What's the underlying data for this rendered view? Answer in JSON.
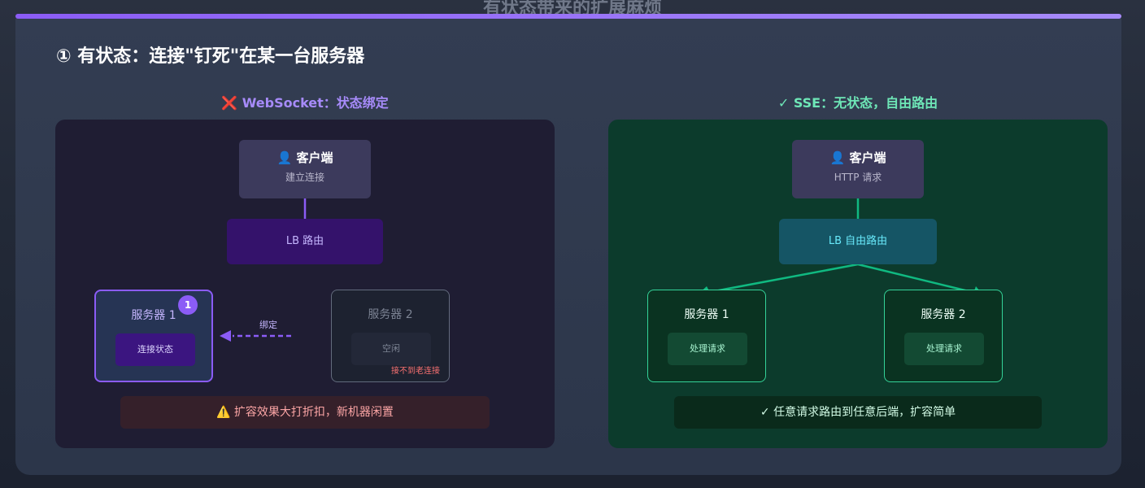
{
  "page": {
    "title": "有状态带来的扩展麻烦",
    "section_title": "① 有状态：连接\"钉死\"在某一台服务器"
  },
  "left": {
    "heading": "❌ WebSocket：状态绑定",
    "client": {
      "icon": "user-icon",
      "title": "👤 客户端",
      "sub": "建立连接"
    },
    "lb": "LB 路由",
    "server1": {
      "title": "服务器 1",
      "inner": "连接状态",
      "badge": "1"
    },
    "bind_label": "绑定",
    "server2": {
      "title": "服务器 2",
      "inner": "空闲",
      "note": "接不到老连接"
    },
    "footer": "⚠️ 扩容效果大打折扣，新机器闲置"
  },
  "right": {
    "heading": "✓ SSE：无状态，自由路由",
    "client": {
      "icon": "user-icon",
      "title": "👤 客户端",
      "sub": "HTTP 请求"
    },
    "lb": "LB 自由路由",
    "server1": {
      "title": "服务器 1",
      "inner": "处理请求"
    },
    "server2": {
      "title": "服务器 2",
      "inner": "处理请求"
    },
    "footer": "✓ 任意请求路由到任意后端，扩容简单"
  },
  "colors": {
    "accent_purple": "#8b5cf6",
    "accent_green": "#34d399",
    "error_red": "#f87171",
    "lb_cyan": "#67e8f9"
  }
}
